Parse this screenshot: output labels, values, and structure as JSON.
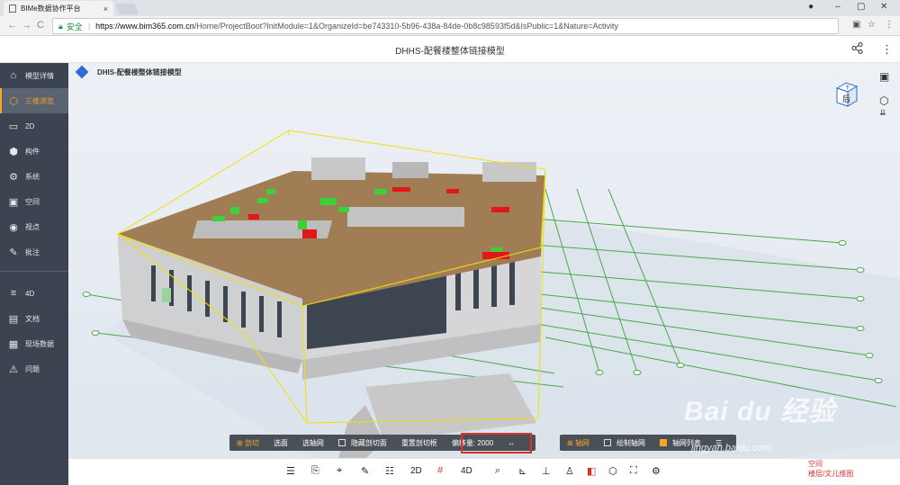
{
  "browser": {
    "tab_title": "BIMe数据协作平台",
    "tab_close": "×",
    "window_minimize": "–",
    "window_restore": "▢",
    "window_close": "✕",
    "back": "←",
    "forward": "→",
    "reload": "C",
    "secure_label": "安全",
    "url_host": "https://www.bim365.com.cn",
    "url_path": "/Home/ProjectBoot?InitModule=1&OrganizeId=be743310-5b96-438a-84de-0b8c98593f5d&IsPublic=1&Nature=Activity",
    "bookmark_star": "☆",
    "menu": "⋮"
  },
  "header": {
    "title": "DHHS-配餐楼整体链接模型",
    "share_icon": "share-icon",
    "menu_icon": "⋮"
  },
  "sidebar": {
    "items": [
      {
        "label": "模型详情",
        "icon": "⌂"
      },
      {
        "label": "三维浏览",
        "icon": "⬡"
      },
      {
        "label": "2D",
        "icon": "▭"
      },
      {
        "label": "构件",
        "icon": "⬢"
      },
      {
        "label": "系统",
        "icon": "⚙"
      },
      {
        "label": "空间",
        "icon": "▣"
      },
      {
        "label": "视点",
        "icon": "◉"
      },
      {
        "label": "批注",
        "icon": "✎"
      }
    ],
    "items2": [
      {
        "label": "4D",
        "icon": "≡"
      },
      {
        "label": "文档",
        "icon": "▤"
      },
      {
        "label": "现场数据",
        "icon": "▦"
      },
      {
        "label": "问题",
        "icon": "⚠"
      }
    ],
    "active_index": 1,
    "accent": "#f5a623"
  },
  "viewport": {
    "title": "DHIS-配餐楼整体链接模型",
    "view_cube_face": "后",
    "view_cube_top": "下"
  },
  "section_bar": {
    "section": "剖切",
    "select_face": "选面",
    "select_axis": "选轴网",
    "hide_section": "隐藏剖切面",
    "reset_section": "重置剖切框",
    "offset_label": "偏移量:",
    "offset_value": "2000",
    "offset_unit_icon": "↔"
  },
  "grid_bar": {
    "grid": "轴网",
    "draw_grid": "绘制轴网",
    "grid_list": "轴网列表",
    "list_icon": "☰"
  },
  "bottom_tools": {
    "t2d": "2D",
    "t4d": "4D"
  },
  "links": {
    "line1": "空间",
    "line2": "楼层/文儿维图"
  },
  "watermark": {
    "brand": "Bai du 经验",
    "site": "jingyan.baidu.com"
  }
}
